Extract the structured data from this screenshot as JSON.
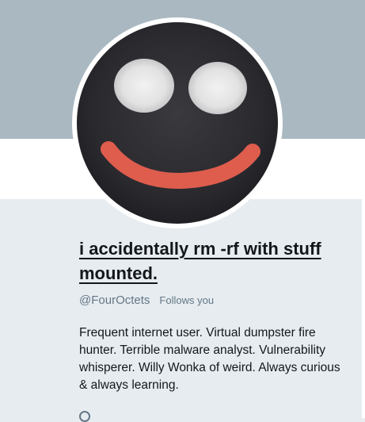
{
  "profile": {
    "display_name": "i accidentally rm -rf with stuff mounted.",
    "handle": "@FourOctets",
    "follows_you": "Follows you",
    "bio": "Frequent internet user. Virtual dumpster fire hunter. Terrible malware analyst. Vulnerability whisperer. Willy Wonka of weird. Always curious & always learning."
  },
  "colors": {
    "banner": "#aab8c2",
    "page_background": "#e6ecf0",
    "avatar_face": "#2a2a2e",
    "avatar_eyes": "#e6e6e6",
    "avatar_smile": "#e8604f",
    "secondary_text": "#657786"
  },
  "icons": {
    "avatar": "smiley-face-avatar",
    "partial_icon": "location-icon"
  }
}
